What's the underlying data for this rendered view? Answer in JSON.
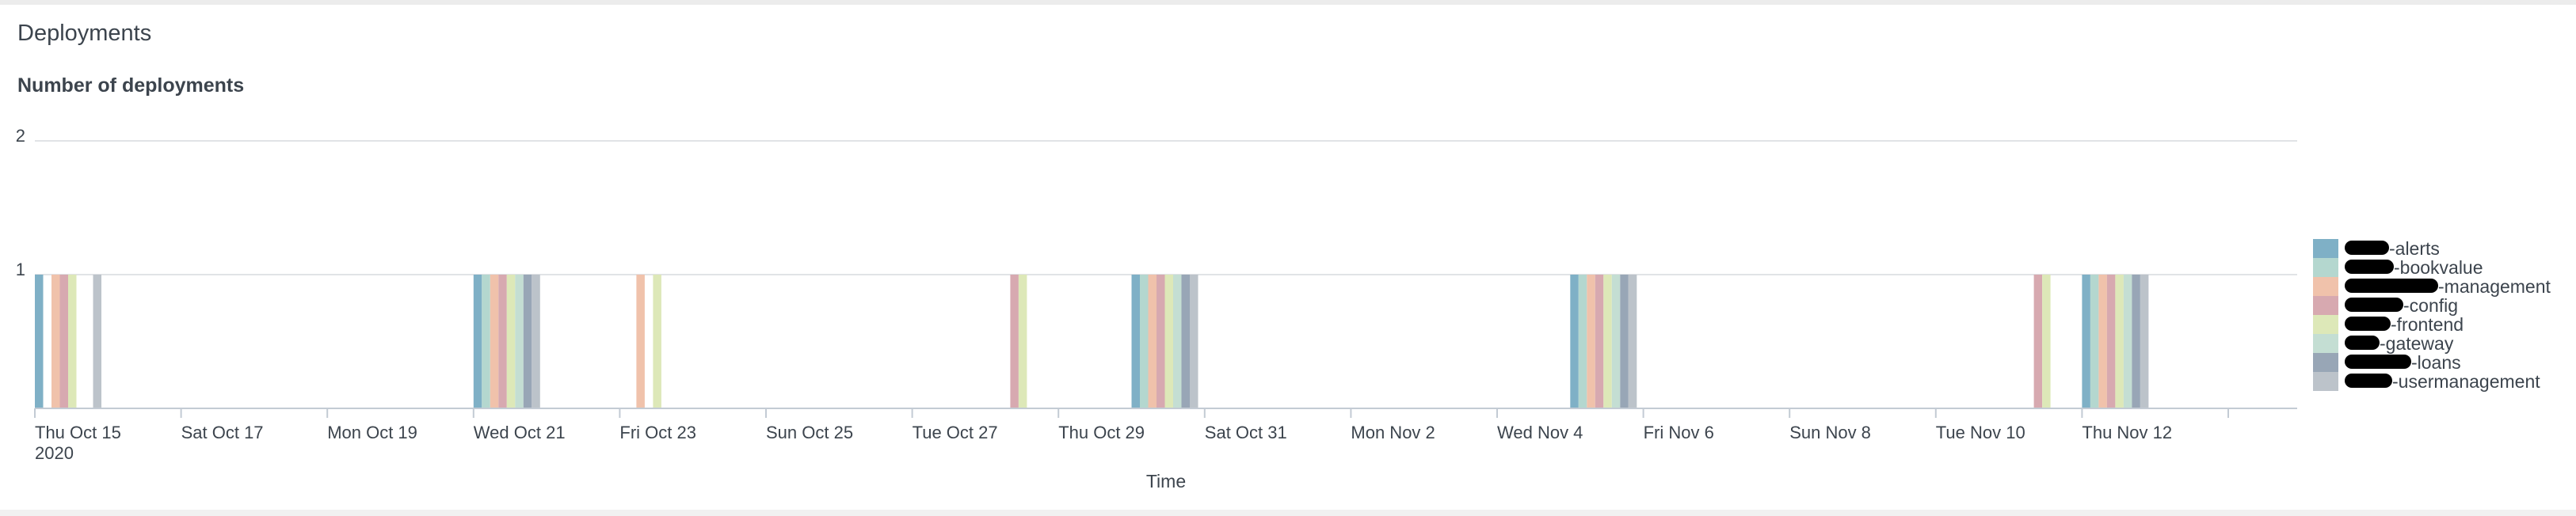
{
  "panel": {
    "title": "Deployments"
  },
  "chart_data": {
    "type": "bar",
    "title": "Number of deployments",
    "xlabel": "Time",
    "ylabel": "",
    "ylim": [
      0,
      2
    ],
    "y_ticks": [
      "1",
      "2"
    ],
    "x_tick_labels": [
      "Thu Oct 15",
      "Sat Oct 17",
      "Mon Oct 19",
      "Wed Oct 21",
      "Fri Oct 23",
      "Sun Oct 25",
      "Tue Oct 27",
      "Thu Oct 29",
      "Sat Oct 31",
      "Mon Nov 2",
      "Wed Nov 4",
      "Fri Nov 6",
      "Sun Nov 8",
      "Tue Nov 10",
      "Thu Nov 12"
    ],
    "x_year_label": "2020",
    "grid": true,
    "legend_position": "right",
    "categories": [
      "Oct 15",
      "Oct 21",
      "Oct 23",
      "Oct 28",
      "Oct 30",
      "Nov 5",
      "Nov 11",
      "Nov 12"
    ],
    "series": [
      {
        "name": "-alerts",
        "color": "#7fb0c6",
        "values": [
          1,
          1,
          0,
          0,
          1,
          1,
          0,
          1
        ]
      },
      {
        "name": "-bookvalue",
        "color": "#b4d7cf",
        "values": [
          0,
          1,
          0,
          0,
          1,
          1,
          0,
          1
        ]
      },
      {
        "name": "-management",
        "color": "#f0c2ab",
        "values": [
          1,
          1,
          1,
          0,
          1,
          1,
          0,
          1
        ]
      },
      {
        "name": "-config",
        "color": "#d7a9b0",
        "values": [
          1,
          1,
          0,
          1,
          1,
          1,
          1,
          1
        ]
      },
      {
        "name": "-frontend",
        "color": "#dde8b8",
        "values": [
          1,
          1,
          1,
          1,
          1,
          1,
          1,
          1
        ]
      },
      {
        "name": "-gateway",
        "color": "#c4ded3",
        "values": [
          0,
          1,
          0,
          0,
          1,
          1,
          0,
          1
        ]
      },
      {
        "name": "-loans",
        "color": "#98a6b6",
        "values": [
          0,
          1,
          0,
          0,
          1,
          1,
          0,
          1
        ]
      },
      {
        "name": "-usermanagement",
        "color": "#bcc3ca",
        "values": [
          1,
          1,
          0,
          0,
          1,
          1,
          0,
          1
        ]
      }
    ]
  }
}
